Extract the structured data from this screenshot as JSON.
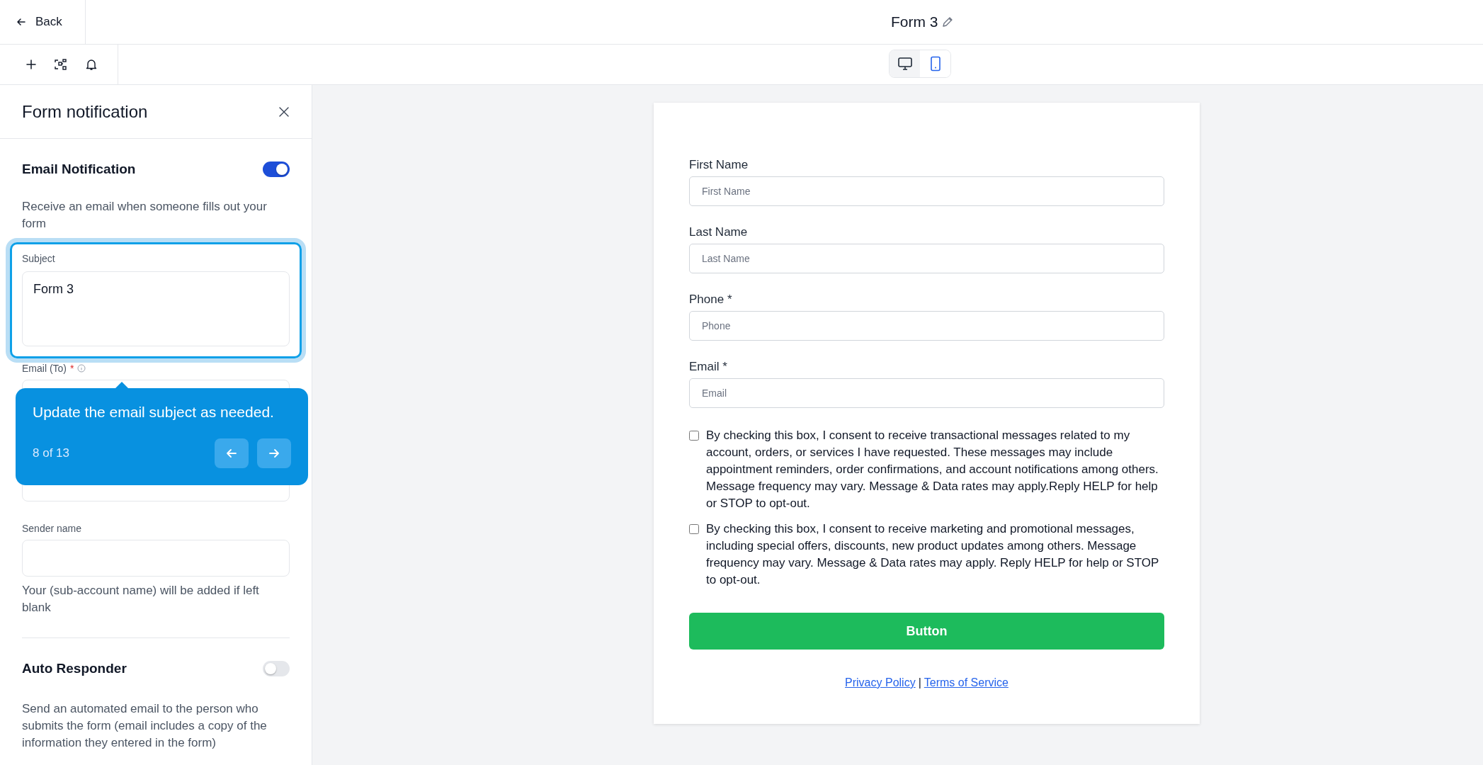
{
  "header": {
    "back_label": "Back",
    "title": "Form 3"
  },
  "device_toggle": [
    {
      "kind": "desktop",
      "selected": true
    },
    {
      "kind": "mobile",
      "selected": false
    }
  ],
  "panel": {
    "title": "Form notification",
    "email_notification": {
      "title": "Email Notification",
      "on": true,
      "description": "Receive an email when someone fills out your form",
      "subject": {
        "label": "Subject",
        "value": "Form 3",
        "highlighted": true
      },
      "email_to": {
        "label": "Email (To)",
        "required_mark": "*"
      },
      "sender_name": {
        "label": "Sender name",
        "help": "Your (sub-account name) will be added if left blank"
      }
    },
    "auto_responder": {
      "title": "Auto Responder",
      "on": false,
      "description": "Send an automated email to the person who submits the form (email includes a copy of the information they entered in the form)"
    }
  },
  "tour_tooltip": {
    "text": "Update the email subject as needed.",
    "step": "8 of 13"
  },
  "form": {
    "fields": [
      {
        "label": "First Name",
        "placeholder": "First Name"
      },
      {
        "label": "Last Name",
        "placeholder": "Last Name"
      },
      {
        "label": "Phone *",
        "placeholder": "Phone"
      },
      {
        "label": "Email *",
        "placeholder": "Email"
      }
    ],
    "consents": [
      {
        "text": "By checking this box, I consent to receive transactional messages related to my account, orders, or services I have requested. These messages may include appointment reminders, order confirmations, and account notifications among others. Message frequency may vary. Message & Data rates may apply.Reply HELP for help or STOP to opt-out.",
        "checked": false
      },
      {
        "text": "By checking this box, I consent to receive marketing and promotional messages, including special offers, discounts, new product updates among others. Message frequency may vary. Message & Data rates may apply. Reply HELP for help or STOP to opt-out.",
        "checked": false
      }
    ],
    "button_label": "Button",
    "links": [
      "Privacy Policy",
      "Terms of Service"
    ],
    "link_separator": "|"
  }
}
